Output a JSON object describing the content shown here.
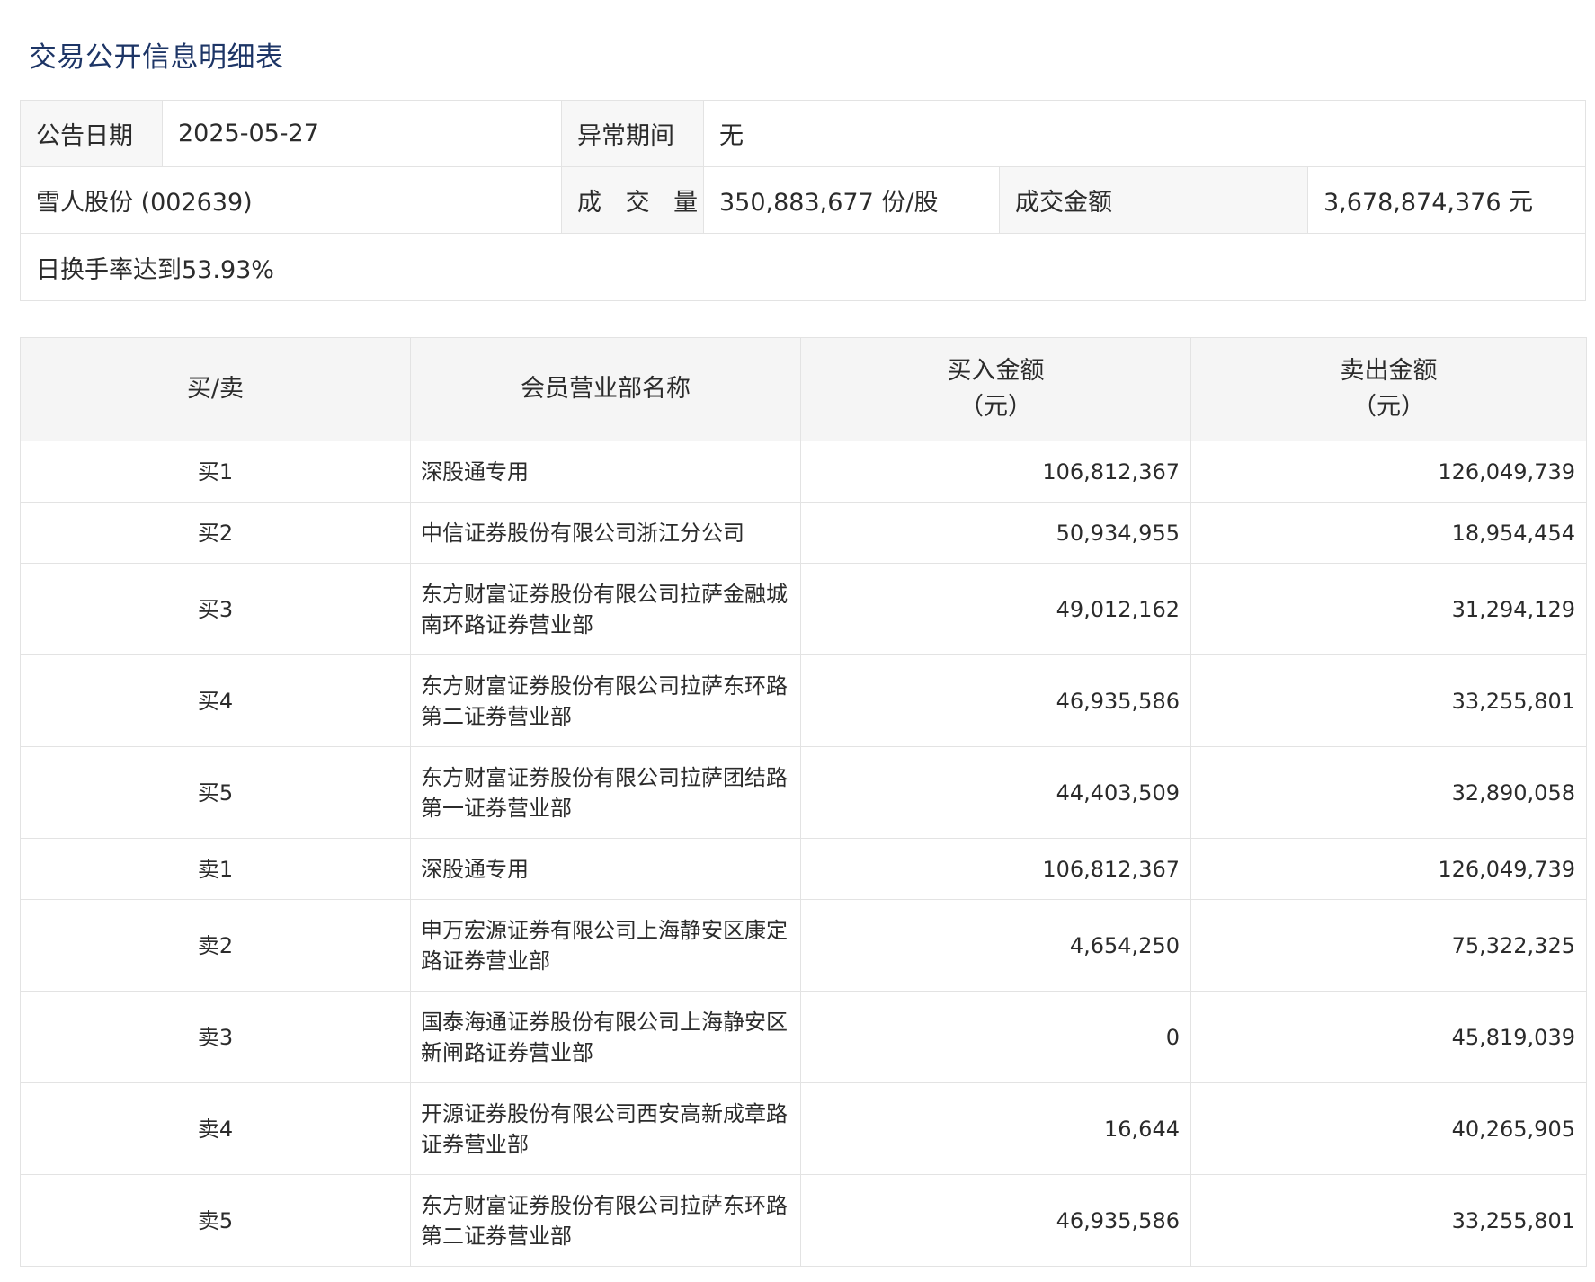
{
  "page": {
    "title": "交易公开信息明细表"
  },
  "summary": {
    "announce_date_label": "公告日期",
    "announce_date_value": "2025-05-27",
    "abnormal_period_label": "异常期间",
    "abnormal_period_value": "无",
    "stock_name": "雪人股份 (002639)",
    "volume_label": "成 交 量",
    "volume_value": "350,883,677 份/股",
    "turnover_label": "成交金额",
    "turnover_value": "3,678,874,376 元",
    "reason": "日换手率达到53.93%"
  },
  "detail": {
    "headers": {
      "side": "买/卖",
      "member": "会员营业部名称",
      "buy_amount": "买入金额",
      "buy_unit": "（元）",
      "sell_amount": "卖出金额",
      "sell_unit": "（元）"
    },
    "rows": [
      {
        "side": "买1",
        "name": "深股通专用",
        "buy": "106,812,367",
        "sell": "126,049,739"
      },
      {
        "side": "买2",
        "name": "中信证券股份有限公司浙江分公司",
        "buy": "50,934,955",
        "sell": "18,954,454"
      },
      {
        "side": "买3",
        "name": "东方财富证券股份有限公司拉萨金融城南环路证券营业部",
        "buy": "49,012,162",
        "sell": "31,294,129"
      },
      {
        "side": "买4",
        "name": "东方财富证券股份有限公司拉萨东环路第二证券营业部",
        "buy": "46,935,586",
        "sell": "33,255,801"
      },
      {
        "side": "买5",
        "name": "东方财富证券股份有限公司拉萨团结路第一证券营业部",
        "buy": "44,403,509",
        "sell": "32,890,058"
      },
      {
        "side": "卖1",
        "name": "深股通专用",
        "buy": "106,812,367",
        "sell": "126,049,739"
      },
      {
        "side": "卖2",
        "name": "申万宏源证券有限公司上海静安区康定路证券营业部",
        "buy": "4,654,250",
        "sell": "75,322,325"
      },
      {
        "side": "卖3",
        "name": "国泰海通证券股份有限公司上海静安区新闸路证券营业部",
        "buy": "0",
        "sell": "45,819,039"
      },
      {
        "side": "卖4",
        "name": "开源证券股份有限公司西安高新成章路证券营业部",
        "buy": "16,644",
        "sell": "40,265,905"
      },
      {
        "side": "卖5",
        "name": "东方财富证券股份有限公司拉萨东环路第二证券营业部",
        "buy": "46,935,586",
        "sell": "33,255,801"
      }
    ]
  }
}
